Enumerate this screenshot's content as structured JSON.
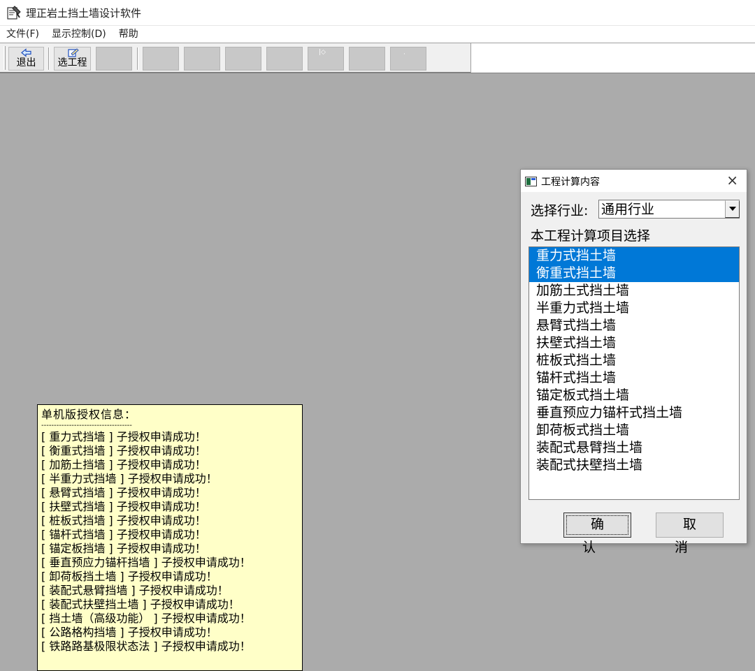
{
  "window": {
    "title": "理正岩土挡土墙设计软件"
  },
  "menu": {
    "items": [
      "文件(F)",
      "显示控制(D)",
      "帮助"
    ]
  },
  "toolbar": {
    "exit_label": "退出",
    "select_project_label": "选工程"
  },
  "license_panel": {
    "title": "单机版授权信息：",
    "divider": "------------------------------------",
    "lines": [
      "[ 重力式挡墙 ] 子授权申请成功！",
      "[ 衡重式挡墙 ] 子授权申请成功！",
      "[ 加筋土挡墙 ] 子授权申请成功！",
      "[ 半重力式挡墙 ] 子授权申请成功！",
      "[ 悬臂式挡墙 ] 子授权申请成功！",
      "[ 扶壁式挡墙 ] 子授权申请成功！",
      "[ 桩板式挡墙 ] 子授权申请成功！",
      "[ 锚杆式挡墙 ] 子授权申请成功！",
      "[ 锚定板挡墙 ] 子授权申请成功！",
      "[ 垂直预应力锚杆挡墙 ] 子授权申请成功！",
      "[ 卸荷板挡土墙 ] 子授权申请成功！",
      "[ 装配式悬臂挡墙 ] 子授权申请成功！",
      "[ 装配式扶壁挡土墙 ] 子授权申请成功！",
      "[ 挡土墙（高级功能） ] 子授权申请成功！",
      "[ 公路格构挡墙 ] 子授权申请成功！",
      "[ 铁路路基极限状态法 ] 子授权申请成功！"
    ]
  },
  "dialog": {
    "title": "工程计算内容",
    "close_glyph": "×",
    "industry_label": "选择行业:",
    "industry_value": "通用行业",
    "items_heading": "本工程计算项目选择",
    "items": [
      {
        "label": "重力式挡土墙",
        "selected": true
      },
      {
        "label": "衡重式挡土墙",
        "selected": true
      },
      {
        "label": "加筋土式挡土墙",
        "selected": false
      },
      {
        "label": "半重力式挡土墙",
        "selected": false
      },
      {
        "label": "悬臂式挡土墙",
        "selected": false
      },
      {
        "label": "扶壁式挡土墙",
        "selected": false
      },
      {
        "label": "桩板式挡土墙",
        "selected": false
      },
      {
        "label": "锚杆式挡土墙",
        "selected": false
      },
      {
        "label": "锚定板式挡土墙",
        "selected": false
      },
      {
        "label": "垂直预应力锚杆式挡土墙",
        "selected": false
      },
      {
        "label": "卸荷板式挡土墙",
        "selected": false
      },
      {
        "label": "装配式悬臂挡土墙",
        "selected": false
      },
      {
        "label": "装配式扶壁挡土墙",
        "selected": false
      }
    ],
    "ok_label": "确认",
    "cancel_label": "取消"
  },
  "colors": {
    "selection": "#0078d7",
    "workspace": "#ababab",
    "license_bg": "#ffffc8"
  }
}
